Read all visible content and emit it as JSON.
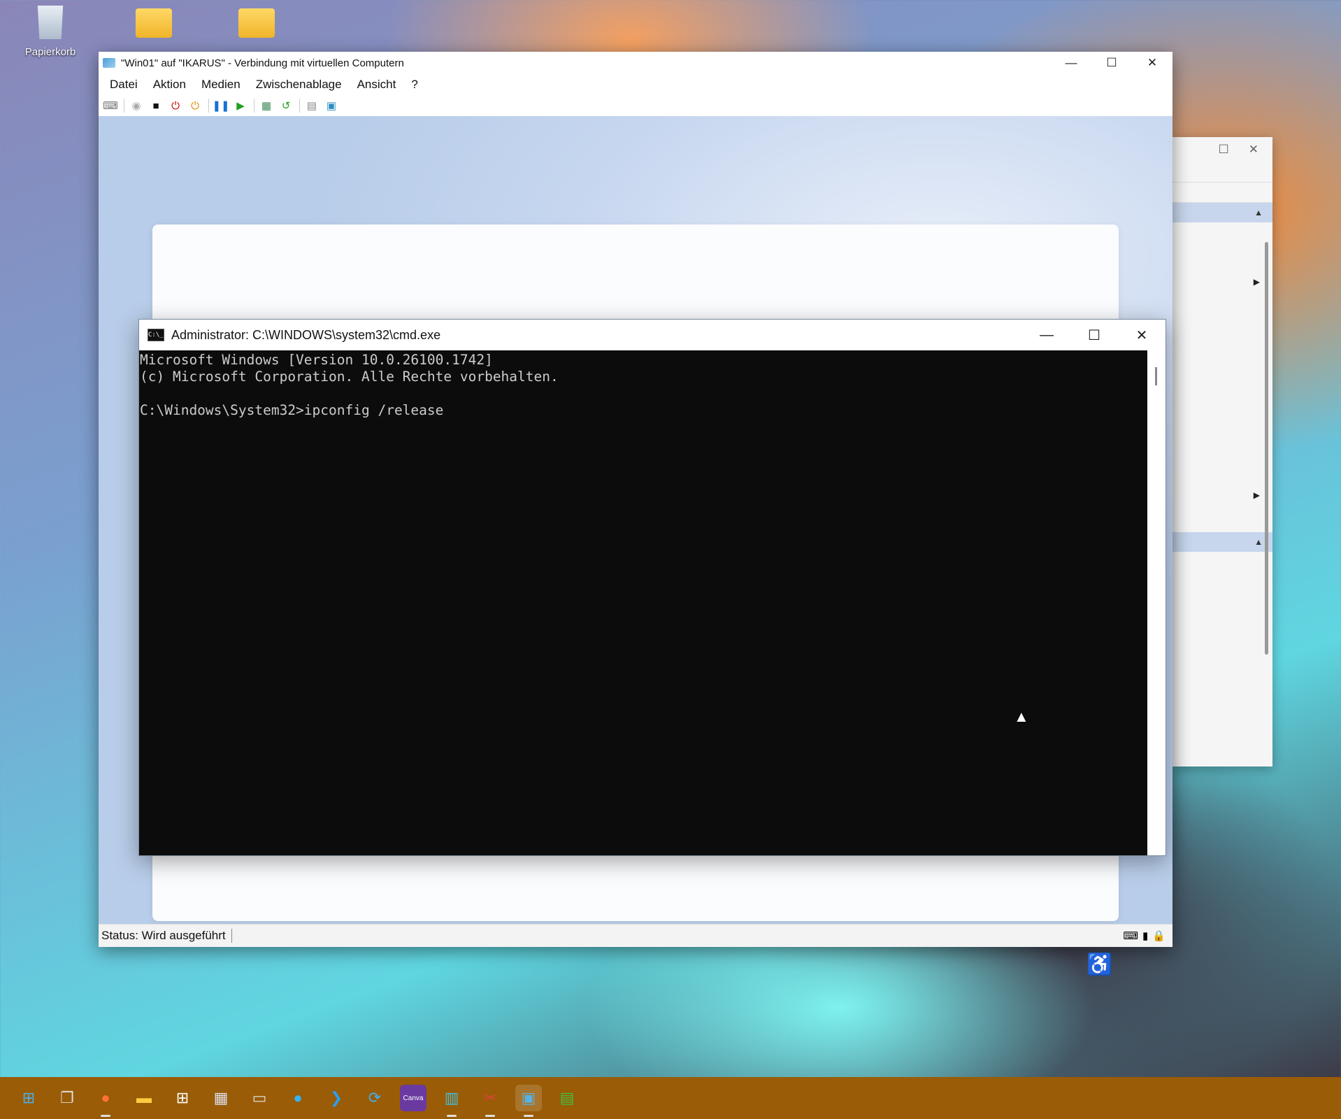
{
  "desktop": {
    "icons": [
      {
        "label": "Papierkorb",
        "icon": "recycle-bin-icon"
      },
      {
        "label": "",
        "icon": "folder-user-icon"
      },
      {
        "label": "",
        "icon": "folder-icon"
      }
    ]
  },
  "vm_window": {
    "title": "\"Win01\" auf \"IKARUS\" - Verbindung mit virtuellen Computern",
    "menu": [
      "Datei",
      "Aktion",
      "Medien",
      "Zwischenablage",
      "Ansicht",
      "?"
    ],
    "toolbar": [
      "ctrl-alt-del-icon",
      "start-icon",
      "turn-off-icon",
      "shut-down-icon",
      "save-icon",
      "pause-icon",
      "resume-icon",
      "checkpoint-icon",
      "revert-icon",
      "enhanced-session-icon",
      "share-icon"
    ],
    "status": "Status: Wird ausgeführt",
    "status_icons": [
      "keyboard-icon",
      "mouse-icon",
      "lock-icon"
    ]
  },
  "cmd": {
    "title": "Administrator: C:\\WINDOWS\\system32\\cmd.exe",
    "icon_text": "C:\\_",
    "lines": [
      "Microsoft Windows [Version 10.0.26100.1742]",
      "(c) Microsoft Corporation. Alle Rechte vorbehalten.",
      "",
      "C:\\Windows\\System32>ipconfig /release"
    ]
  },
  "window_controls": {
    "minimize": "—",
    "maximize": "☐",
    "close": "✕"
  },
  "taskbar": {
    "items": [
      "start-icon",
      "task-view-icon",
      "firefox-icon",
      "file-explorer-icon",
      "store-icon",
      "calendar-icon",
      "terminal-icon",
      "edge-icon",
      "vscode-icon",
      "sync-icon",
      "canva-icon",
      "azure-icon",
      "snipping-tool-icon",
      "hyper-v-icon",
      "spreadsheet-icon"
    ],
    "canva_label": "Canva"
  }
}
